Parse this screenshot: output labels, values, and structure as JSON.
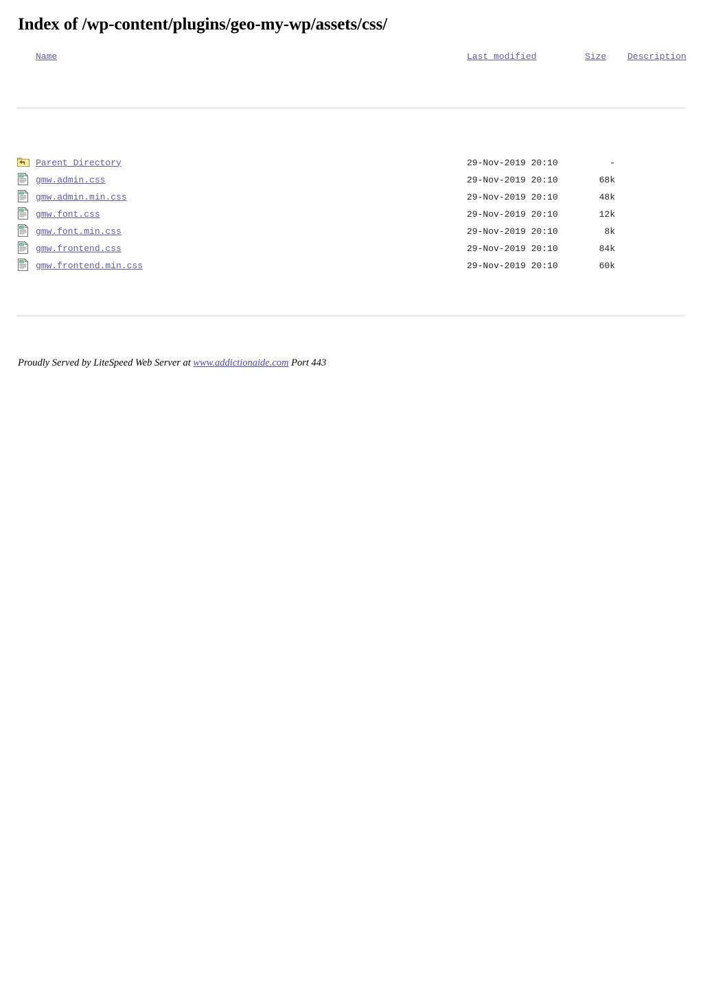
{
  "page": {
    "title": "Index of /wp-content/plugins/geo-my-wp/assets/css/"
  },
  "table": {
    "headers": {
      "name": "Name",
      "last_modified": "Last modified",
      "size": "Size",
      "description": "Description"
    },
    "rows": [
      {
        "icon": "parent-directory-icon",
        "name": "Parent Directory",
        "last_modified": "29-Nov-2019 20:10",
        "size": "-",
        "description": ""
      },
      {
        "icon": "text-file-icon",
        "name": "gmw.admin.css",
        "last_modified": "29-Nov-2019 20:10",
        "size": "68k",
        "description": ""
      },
      {
        "icon": "text-file-icon",
        "name": "gmw.admin.min.css",
        "last_modified": "29-Nov-2019 20:10",
        "size": "48k",
        "description": ""
      },
      {
        "icon": "text-file-icon",
        "name": "gmw.font.css",
        "last_modified": "29-Nov-2019 20:10",
        "size": "12k",
        "description": ""
      },
      {
        "icon": "text-file-icon",
        "name": "gmw.font.min.css",
        "last_modified": "29-Nov-2019 20:10",
        "size": "8k",
        "description": ""
      },
      {
        "icon": "text-file-icon",
        "name": "gmw.frontend.css",
        "last_modified": "29-Nov-2019 20:10",
        "size": "84k",
        "description": ""
      },
      {
        "icon": "text-file-icon",
        "name": "gmw.frontend.min.css",
        "last_modified": "29-Nov-2019 20:10",
        "size": "60k",
        "description": ""
      }
    ]
  },
  "footer": {
    "prefix": "Proudly Served by LiteSpeed Web Server at ",
    "host_link": "www.addictionaide.com",
    "suffix": " Port 443"
  },
  "colors": {
    "link": "#5b5bb0",
    "rule": "#ececec",
    "text": "#000000",
    "folder_icon": "#e8e27a",
    "file_icon_accent": "#2f8f5b"
  }
}
